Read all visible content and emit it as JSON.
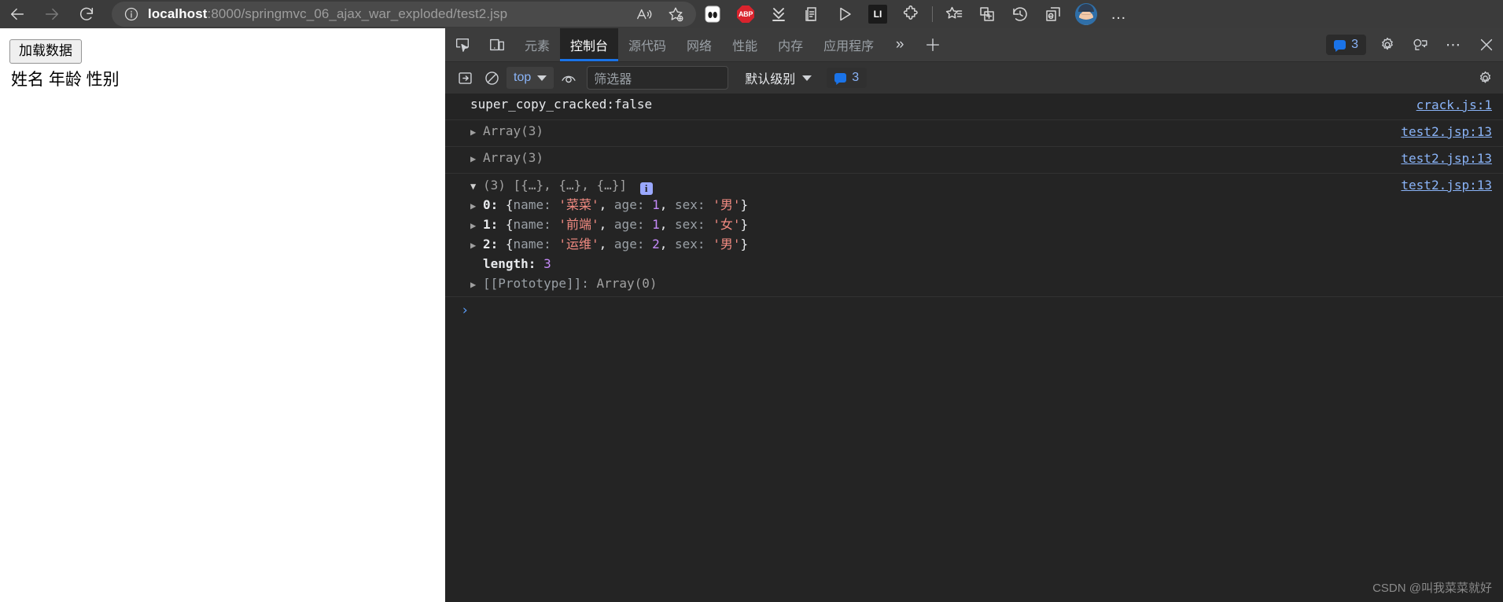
{
  "browser": {
    "nav": {
      "back_label": "back-arrow",
      "forward_label": "forward-arrow",
      "refresh_label": "refresh"
    },
    "address": {
      "host": "localhost",
      "path": ":8000/springmvc_06_ajax_war_exploded/test2.jsp",
      "full": "localhost:8000/springmvc_06_ajax_war_exploded/test2.jsp",
      "info_icon": "site-information-icon"
    },
    "toolbar_icons": [
      {
        "name": "read-aloud-icon",
        "label": "A"
      },
      {
        "name": "add-favorite-icon",
        "label": "☆"
      },
      {
        "name": "extension-glasses-icon",
        "label": "oo"
      },
      {
        "name": "adblock-plus-icon",
        "label": "ABP"
      },
      {
        "name": "downloads-icon",
        "label": "⤓"
      },
      {
        "name": "collections-icon",
        "label": "⧉"
      },
      {
        "name": "media-play-icon",
        "label": "▷"
      },
      {
        "name": "linkedin-badge-icon",
        "label": "LI"
      },
      {
        "name": "extensions-puzzle-icon",
        "label": "❖"
      },
      {
        "name": "favorites-icon",
        "label": "★"
      },
      {
        "name": "split-screen-icon",
        "label": "⊞"
      },
      {
        "name": "history-icon",
        "label": "↺"
      },
      {
        "name": "ie-mode-icon",
        "label": "e"
      },
      {
        "name": "profile-avatar",
        "label": "profile"
      },
      {
        "name": "settings-more-icon",
        "label": "…"
      }
    ]
  },
  "page": {
    "load_button": "加载数据",
    "table_header": "姓名 年龄 性别"
  },
  "devtools": {
    "tools": [
      {
        "name": "inspect-element-icon"
      },
      {
        "name": "device-toolbar-icon"
      }
    ],
    "tabs": [
      {
        "id": "elements",
        "label": "元素",
        "active": false
      },
      {
        "id": "console",
        "label": "控制台",
        "active": true
      },
      {
        "id": "sources",
        "label": "源代码",
        "active": false
      },
      {
        "id": "network",
        "label": "网络",
        "active": false
      },
      {
        "id": "performance",
        "label": "性能",
        "active": false
      },
      {
        "id": "memory",
        "label": "内存",
        "active": false
      },
      {
        "id": "application",
        "label": "应用程序",
        "active": false
      }
    ],
    "more_tabs_label": "»",
    "new_tab_label": "+",
    "issues_count": "3",
    "right_icons": [
      {
        "name": "settings-gear-icon"
      },
      {
        "name": "feedback-icon"
      },
      {
        "name": "devtools-more-icon",
        "label": "⋯"
      },
      {
        "name": "devtools-close-icon",
        "label": "✕"
      }
    ],
    "console_bar": {
      "sidebar_toggle": "console-sidebar-toggle-icon",
      "clear_console": "clear-console-icon",
      "context": "top",
      "live_expression": "eye-icon",
      "filter_placeholder": "筛选器",
      "filter_value": "",
      "level": "默认级别",
      "issue_count": "3",
      "settings": "console-settings-gear-icon"
    },
    "messages": [
      {
        "id": "m1",
        "kind": "text",
        "text": "super_copy_cracked:false",
        "source": "crack.js:1"
      },
      {
        "id": "m2",
        "kind": "collapsed-array",
        "text": "Array(3)",
        "source": "test2.jsp:13"
      },
      {
        "id": "m3",
        "kind": "collapsed-array",
        "text": "Array(3)",
        "source": "test2.jsp:13"
      },
      {
        "id": "m4",
        "kind": "expanded-array",
        "summary_count": "(3)",
        "summary_preview": "[{…}, {…}, {…}]",
        "source": "test2.jsp:13",
        "info_badge": "i",
        "items": [
          {
            "index": "0:",
            "name_key": "name:",
            "name_value": "'菜菜'",
            "age_key": "age:",
            "age_value": "1",
            "sex_key": "sex:",
            "sex_value": "'男'"
          },
          {
            "index": "1:",
            "name_key": "name:",
            "name_value": "'前端'",
            "age_key": "age:",
            "age_value": "1",
            "sex_key": "sex:",
            "sex_value": "'女'"
          },
          {
            "index": "2:",
            "name_key": "name:",
            "name_value": "'运维'",
            "age_key": "age:",
            "age_value": "2",
            "sex_key": "sex:",
            "sex_value": "'男'"
          }
        ],
        "length_key": "length:",
        "length_value": "3",
        "prototype_key": "[[Prototype]]:",
        "prototype_value": "Array(0)"
      }
    ],
    "prompt_symbol": "›"
  },
  "watermark": "CSDN @叫我菜菜就好",
  "colors": {
    "accent": "#1a73e8",
    "link": "#8ab4f8",
    "string": "#f28b82",
    "number": "#c58af9",
    "devtools_bg": "#242424"
  }
}
